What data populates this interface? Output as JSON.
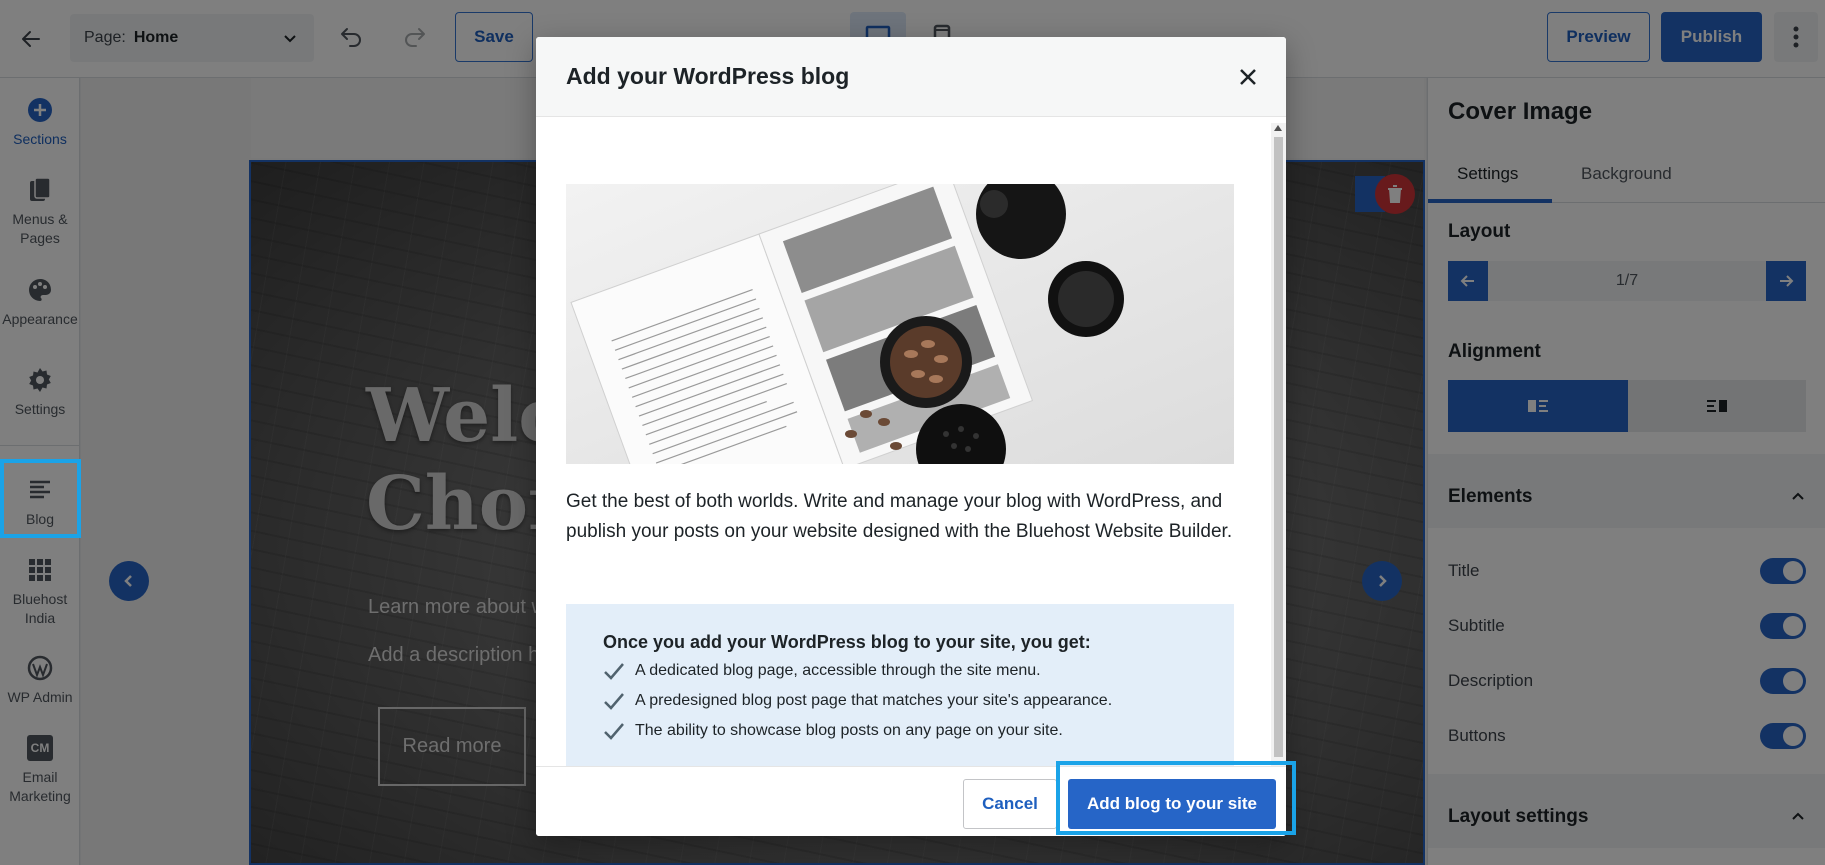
{
  "topbar": {
    "page_label": "Page:",
    "page_value": "Home",
    "save_label": "Save",
    "preview_label": "Preview",
    "publish_label": "Publish"
  },
  "rail": {
    "items": [
      {
        "label": "Sections",
        "icon": "plus-circle-icon"
      },
      {
        "label": "Menus & Pages",
        "icon": "pages-icon"
      },
      {
        "label": "Appearance",
        "icon": "palette-icon"
      },
      {
        "label": "Settings",
        "icon": "gear-icon"
      },
      {
        "label": "Blog",
        "icon": "blog-lines-icon"
      },
      {
        "label": "Bluehost India",
        "icon": "grid-icon"
      },
      {
        "label": "WP Admin",
        "icon": "wordpress-icon"
      },
      {
        "label": "Email Marketing",
        "icon": "cm-icon",
        "badge": "CM"
      }
    ]
  },
  "hero": {
    "title": "Welcome to\nChords",
    "subtitle": "Learn more about what we do",
    "description": "Add a description here.",
    "button_label": "Read more"
  },
  "right_panel": {
    "title": "Cover Image",
    "tabs": [
      "Settings",
      "Background"
    ],
    "active_tab": "Settings",
    "layout_label": "Layout",
    "layout_count": "1/7",
    "alignment_label": "Alignment",
    "elements_label": "Elements",
    "elements": [
      {
        "label": "Title",
        "enabled": true
      },
      {
        "label": "Subtitle",
        "enabled": true
      },
      {
        "label": "Description",
        "enabled": true
      },
      {
        "label": "Buttons",
        "enabled": true
      }
    ],
    "layout_settings_label": "Layout settings"
  },
  "modal": {
    "title": "Add your WordPress blog",
    "intro": "Get the best of both worlds. Write and manage your blog with WordPress, and publish your posts on your website designed with the Bluehost Website Builder.",
    "benefits_title": "Once you add your WordPress blog to your site, you get:",
    "benefits": [
      "A dedicated blog page, accessible through the site menu.",
      "A predesigned blog post page that matches your site's appearance.",
      "The ability to showcase blog posts on any page on your site."
    ],
    "cancel_label": "Cancel",
    "add_label": "Add blog to your site"
  },
  "colors": {
    "primary": "#2665c7",
    "highlight": "#1aa3e8",
    "benefits_bg": "#e3eef9",
    "danger": "#d13438"
  }
}
